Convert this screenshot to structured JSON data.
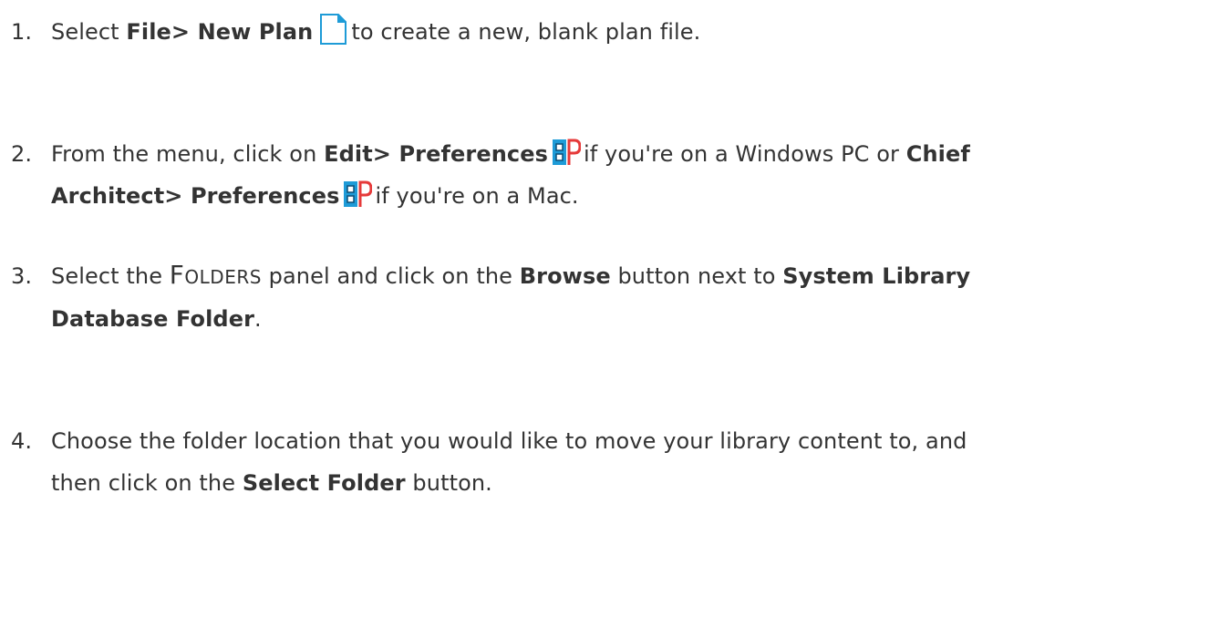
{
  "steps": [
    {
      "num": "1.",
      "select": "Select",
      "menu_path": "File> New Plan",
      "rest": "to create a new, blank plan file.",
      "icon": "new-plan-icon"
    },
    {
      "num": "2.",
      "lead": "From the menu, click on",
      "win_path": "Edit> Preferences",
      "win_suffix": "if you're on a Windows PC or",
      "mac_path_line1": "Chief",
      "mac_path_line2": "Architect> Preferences",
      "mac_suffix": "if you're on a Mac.",
      "icon": "preferences-icon"
    },
    {
      "num": "3.",
      "lead": "Select the",
      "panel_cap": "F",
      "panel_rest": "OLDERS",
      "mid": "panel and click on the",
      "button": "Browse",
      "mid2": "button next to",
      "target_line1": "System Library",
      "target_line2": "Database Folder",
      "end": "."
    },
    {
      "num": "4.",
      "line1": "Choose the folder location that you would like to move your library content to, and",
      "line2_lead": "then click on the",
      "button": "Select Folder",
      "line2_end": "button."
    }
  ],
  "colors": {
    "text": "#333333",
    "icon_blue": "#1e9bd7",
    "icon_red": "#e63a3a"
  }
}
